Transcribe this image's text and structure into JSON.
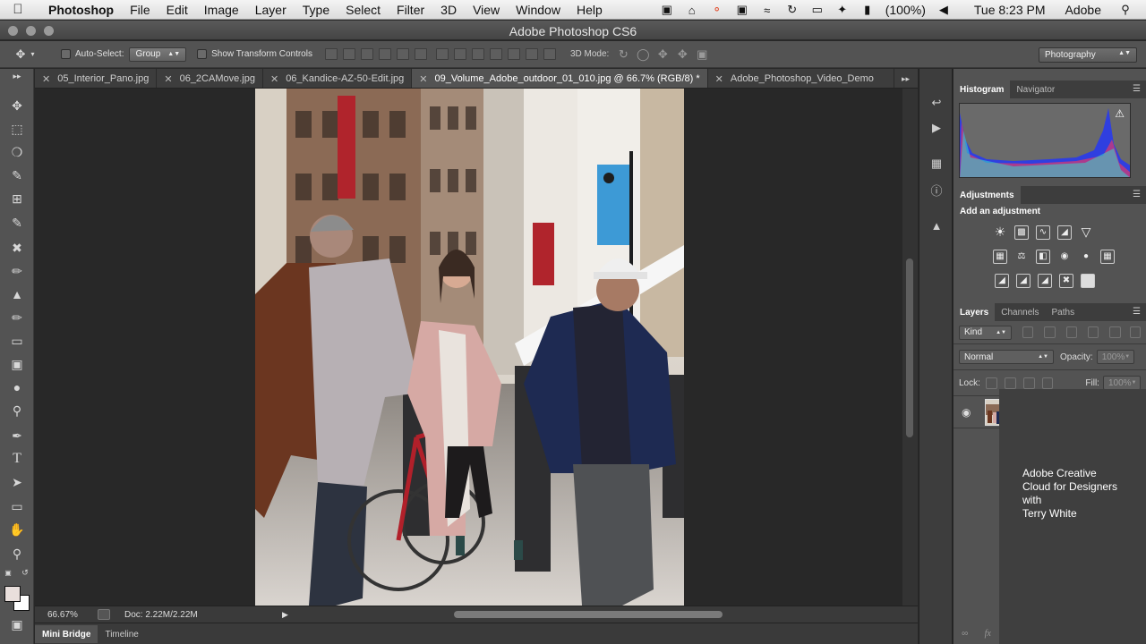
{
  "menubar": {
    "app": "Photoshop",
    "items": [
      "File",
      "Edit",
      "Image",
      "Layer",
      "Type",
      "Select",
      "Filter",
      "3D",
      "View",
      "Window",
      "Help"
    ],
    "battery": "(100%)",
    "clock": "Tue 8:23 PM",
    "user": "Adobe"
  },
  "window": {
    "title": "Adobe Photoshop CS6"
  },
  "options": {
    "auto_select_label": "Auto-Select:",
    "auto_select_value": "Group",
    "transform_label": "Show Transform Controls",
    "mode_3d_label": "3D Mode:",
    "workspace": "Photography"
  },
  "tabs": [
    {
      "label": "05_Interior_Pano.jpg",
      "active": false
    },
    {
      "label": "06_2CAMove.jpg",
      "active": false
    },
    {
      "label": "06_Kandice-AZ-50-Edit.jpg",
      "active": false
    },
    {
      "label": "09_Volume_Adobe_outdoor_01_010.jpg @ 66.7% (RGB/8) *",
      "active": true
    },
    {
      "label": "Adobe_Photoshop_Video_Demo",
      "active": false
    }
  ],
  "status": {
    "zoom": "66.67%",
    "doc": "Doc: 2.22M/2.22M"
  },
  "bottom_tabs": [
    "Mini Bridge",
    "Timeline"
  ],
  "panels": {
    "histogram_tabs": [
      "Histogram",
      "Navigator"
    ],
    "adjustments_tab": "Adjustments",
    "add_adjustment": "Add an adjustment",
    "layers_tabs": [
      "Layers",
      "Channels",
      "Paths"
    ],
    "kind_label": "Kind",
    "blend_mode": "Normal",
    "opacity_label": "Opacity:",
    "opacity_value": "100%",
    "lock_label": "Lock:",
    "fill_label": "Fill:",
    "fill_value": "100%"
  },
  "credit": {
    "line1": "Adobe Creative",
    "line2": "Cloud for Designers",
    "line3": "with",
    "line4": "Terry White"
  },
  "colors": {
    "ui_dark": "#282828",
    "ui_panel": "#535353",
    "foreground": "#e9dfdc",
    "background": "#ffffff"
  }
}
